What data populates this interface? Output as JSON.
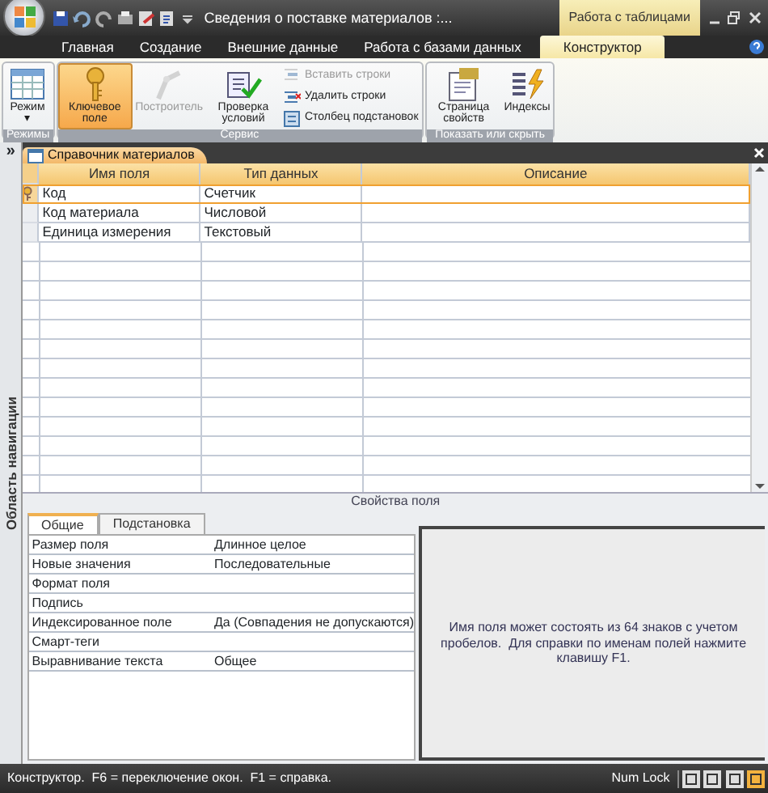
{
  "window": {
    "title": "Сведения о поставке материалов :...",
    "context_tab": "Работа с таблицами"
  },
  "ribbon_tabs": [
    {
      "label": "Главная",
      "selected": false
    },
    {
      "label": "Создание",
      "selected": false
    },
    {
      "label": "Внешние данные",
      "selected": false
    },
    {
      "label": "Работа с базами данных",
      "selected": false
    },
    {
      "label": "Конструктор",
      "selected": true
    }
  ],
  "ribbon_groups": [
    {
      "label": "Режимы",
      "buttons": [
        {
          "kind": "large",
          "label": "Режим",
          "dropdown": "▾",
          "selected": false,
          "disabled": false
        }
      ]
    },
    {
      "label": "Сервис",
      "buttons": [
        {
          "kind": "large",
          "label": "Ключевое поле",
          "selected": true,
          "disabled": false
        },
        {
          "kind": "large",
          "label": "Построитель",
          "selected": false,
          "disabled": true
        },
        {
          "kind": "large",
          "label": "Проверка условий",
          "selected": false,
          "disabled": false
        },
        {
          "kind": "small",
          "label": "Вставить строки",
          "selected": false,
          "disabled": true
        },
        {
          "kind": "small",
          "label": "Удалить строки",
          "selected": false,
          "disabled": false
        },
        {
          "kind": "small",
          "label": "Столбец подстановок",
          "selected": false,
          "disabled": false
        }
      ]
    },
    {
      "label": "Показать или скрыть",
      "buttons": [
        {
          "kind": "large",
          "label": "Страница свойств",
          "selected": false,
          "disabled": false
        },
        {
          "kind": "large",
          "label": "Индексы",
          "selected": false,
          "disabled": false
        }
      ]
    }
  ],
  "navigation_pane": {
    "label": "Область навигации",
    "expand_glyph": "»"
  },
  "document_tab": {
    "label": "Справочник материалов"
  },
  "table": {
    "columns": [
      "Имя поля",
      "Тип данных",
      "Описание"
    ],
    "rows": [
      {
        "name": "Код",
        "type": "Счетчик",
        "primary_key": true,
        "selected": true
      },
      {
        "name": "Код материала",
        "type": "Числовой",
        "primary_key": false,
        "selected": false
      },
      {
        "name": "Единица измерения",
        "type": "Текстовый",
        "primary_key": false,
        "selected": false
      }
    ]
  },
  "field_properties": {
    "title": "Свойства поля",
    "tabs": [
      {
        "label": "Общие",
        "selected": true
      },
      {
        "label": "Подстановка",
        "selected": false
      }
    ],
    "properties": [
      {
        "name": "Размер поля",
        "value": "Длинное целое"
      },
      {
        "name": "Новые значения",
        "value": "Последовательные"
      },
      {
        "name": "Формат поля"
      },
      {
        "name": "Подпись"
      },
      {
        "name": "Индексированное поле",
        "value": "Да (Совпадения не допускаются)"
      },
      {
        "name": "Смарт-теги"
      },
      {
        "name": "Выравнивание текста",
        "value": "Общее"
      }
    ],
    "help": "Имя поля может состоять из 64 знаков с учетом пробелов.  Для справки по именам полей нажмите клавишу F1."
  },
  "status_bar": {
    "text": "Конструктор.  F6 = переключение окон.  F1 = справка.",
    "num_lock": "Num Lock",
    "views": [
      {
        "selected": false
      },
      {
        "selected": false
      },
      {
        "selected": false
      },
      {
        "selected": true
      }
    ]
  }
}
